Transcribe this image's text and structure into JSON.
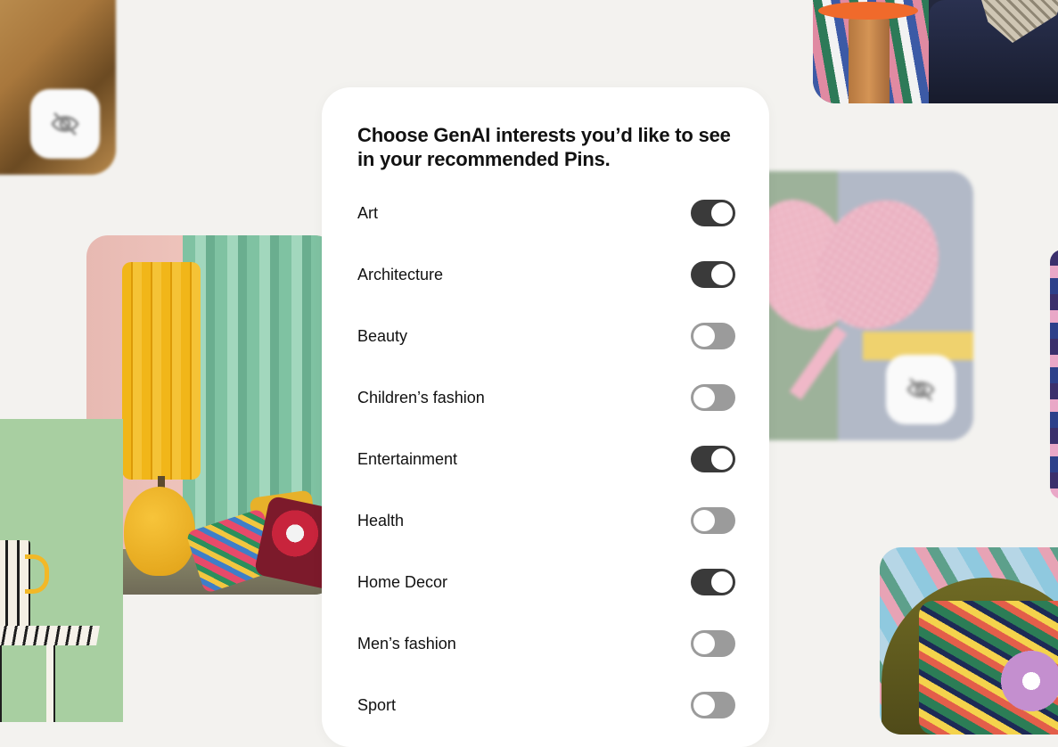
{
  "card": {
    "title": "Choose GenAI interests you’d like to see in your recommended Pins."
  },
  "interests": [
    {
      "label": "Art",
      "enabled": true
    },
    {
      "label": "Architecture",
      "enabled": true
    },
    {
      "label": "Beauty",
      "enabled": false
    },
    {
      "label": "Children’s fashion",
      "enabled": false
    },
    {
      "label": "Entertainment",
      "enabled": true
    },
    {
      "label": "Health",
      "enabled": false
    },
    {
      "label": "Home Decor",
      "enabled": true
    },
    {
      "label": "Men’s fashion",
      "enabled": false
    },
    {
      "label": "Sport",
      "enabled": false
    }
  ],
  "pins": [
    {
      "name": "top-left-pin",
      "hidden_icon": "eye-off-icon"
    },
    {
      "name": "top-right-pin"
    },
    {
      "name": "lamp-pin"
    },
    {
      "name": "cup-pin"
    },
    {
      "name": "paddles-pin",
      "hidden_icon": "eye-off-icon"
    },
    {
      "name": "chair-pin"
    },
    {
      "name": "edge-pin"
    }
  ],
  "colors": {
    "background": "#f3f2ef",
    "card": "#ffffff",
    "toggle_on": "#3a3a3a",
    "toggle_off": "#9b9b9b"
  }
}
